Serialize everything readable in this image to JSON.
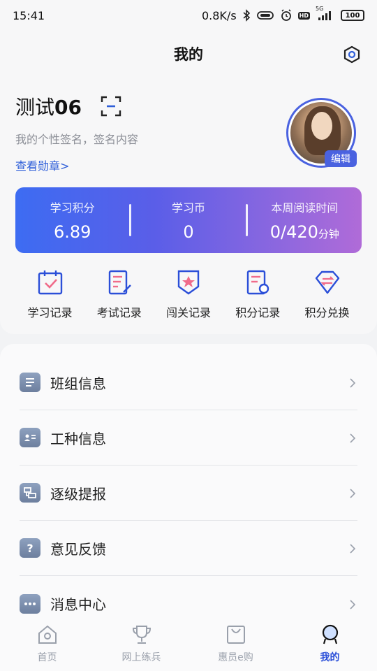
{
  "status_bar": {
    "time": "15:41",
    "network_speed": "0.8K/s",
    "signal_label": "5G",
    "hd_label": "HD",
    "battery": "100"
  },
  "header": {
    "title": "我的"
  },
  "profile": {
    "name_prefix": "测试",
    "name_suffix": "06",
    "signature": "我的个性签名，签名内容",
    "medal_link": "查看勋章>",
    "edit_badge": "编辑"
  },
  "stats": [
    {
      "label": "学习积分",
      "value": "6.89",
      "unit": ""
    },
    {
      "label": "学习币",
      "value": "0",
      "unit": ""
    },
    {
      "label": "本周阅读时间",
      "value": "0/420",
      "unit": "分钟"
    }
  ],
  "quick_actions": [
    {
      "label": "学习记录",
      "icon": "calendar-check-icon"
    },
    {
      "label": "考试记录",
      "icon": "edit-document-icon"
    },
    {
      "label": "闯关记录",
      "icon": "shield-star-icon"
    },
    {
      "label": "积分记录",
      "icon": "record-search-icon"
    },
    {
      "label": "积分兑换",
      "icon": "diamond-exchange-icon"
    }
  ],
  "menu": [
    {
      "label": "班组信息",
      "icon": "list-icon"
    },
    {
      "label": "工种信息",
      "icon": "id-card-icon"
    },
    {
      "label": "逐级提报",
      "icon": "hierarchy-icon"
    },
    {
      "label": "意见反馈",
      "icon": "question-icon"
    },
    {
      "label": "消息中心",
      "icon": "message-dots-icon"
    }
  ],
  "bottom_nav": [
    {
      "label": "首页",
      "icon": "home-icon"
    },
    {
      "label": "网上练兵",
      "icon": "trophy-icon"
    },
    {
      "label": "惠员e购",
      "icon": "shopping-bag-icon"
    },
    {
      "label": "我的",
      "icon": "profile-icon",
      "active": true
    }
  ],
  "colors": {
    "accent": "#2f5fd9",
    "card_gradient_start": "#3d6cf2",
    "card_gradient_end": "#b06bd8",
    "active_nav": "#2b4fd8"
  }
}
